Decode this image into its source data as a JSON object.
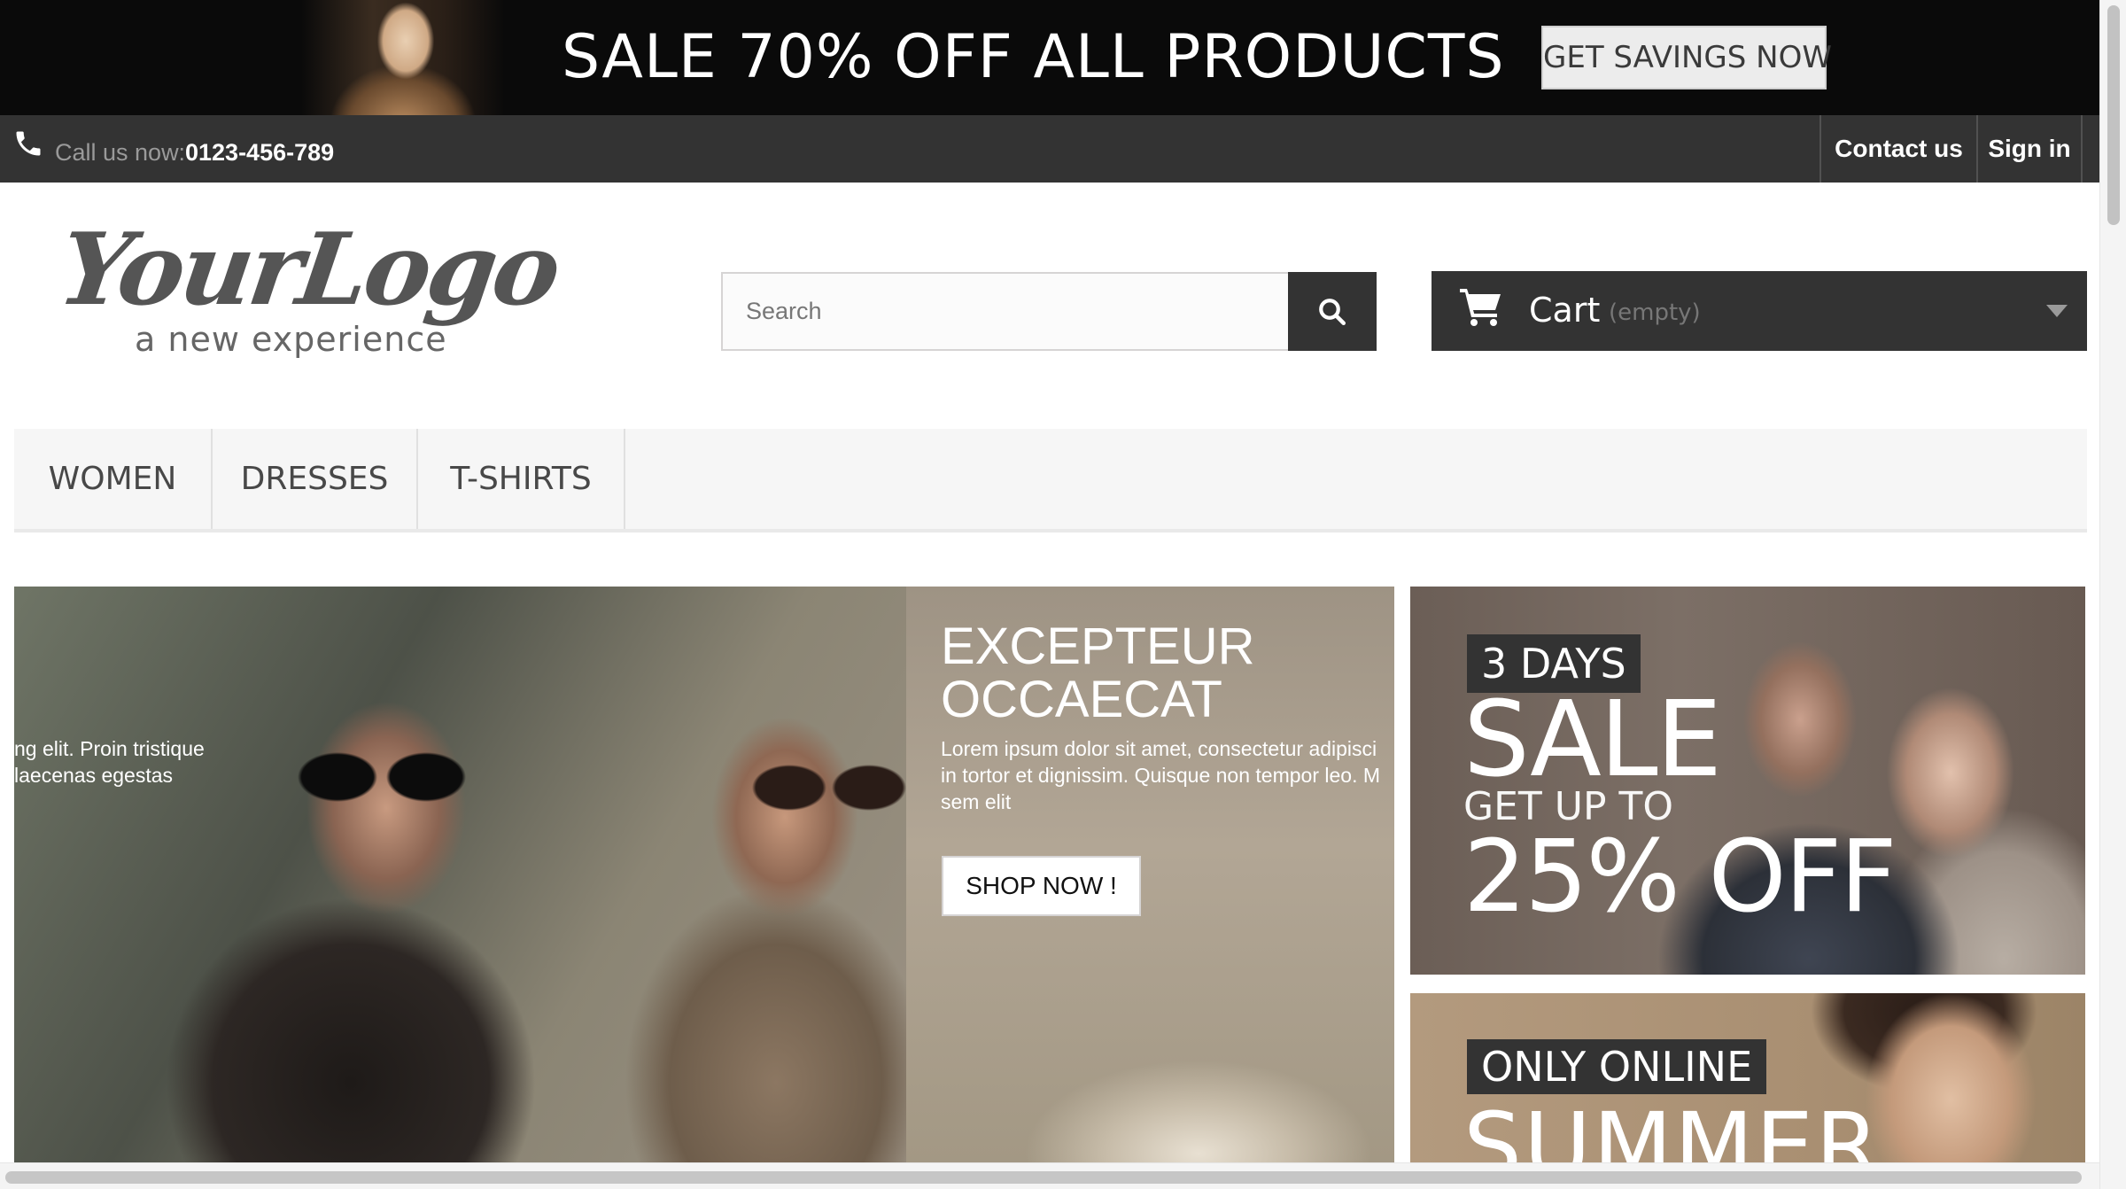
{
  "promo": {
    "headline": "SALE 70% OFF ALL PRODUCTS",
    "button_label": "GET SAVINGS NOW"
  },
  "topbar": {
    "call_label": "Call us now:",
    "phone": "0123-456-789",
    "contact_label": "Contact us",
    "signin_label": "Sign in"
  },
  "logo": {
    "main": "YourLogo",
    "tagline": "a new experience"
  },
  "search": {
    "placeholder": "Search",
    "value": ""
  },
  "cart": {
    "title": "Cart",
    "status": "(empty)"
  },
  "menu": {
    "items": [
      "WOMEN",
      "DRESSES",
      "T-SHIRTS"
    ]
  },
  "slider": {
    "title_line1": "EXCEPTEUR",
    "title_line2": "OCCAECAT",
    "body_lines": [
      "Lorem ipsum dolor sit amet, consectetur adipisci",
      "in tortor et dignissim. Quisque non tempor leo. M",
      "sem elit"
    ],
    "left_fragment_lines": [
      "ng elit. Proin tristique",
      "laecenas egestas"
    ],
    "button_label": "SHOP NOW !"
  },
  "banners": {
    "sale": {
      "tag": "3 DAYS",
      "word": "SALE",
      "sub": "GET UP TO",
      "percent": "25% OFF"
    },
    "summer": {
      "tag": "ONLY ONLINE",
      "word": "SUMMER"
    }
  },
  "colors": {
    "dark_bar": "#333333",
    "promo_bg": "#0a0a0a",
    "menu_bg": "#f6f6f6",
    "muted_text": "#777777"
  },
  "icons": [
    "phone-icon",
    "search-icon",
    "cart-icon",
    "chevron-down-icon"
  ]
}
